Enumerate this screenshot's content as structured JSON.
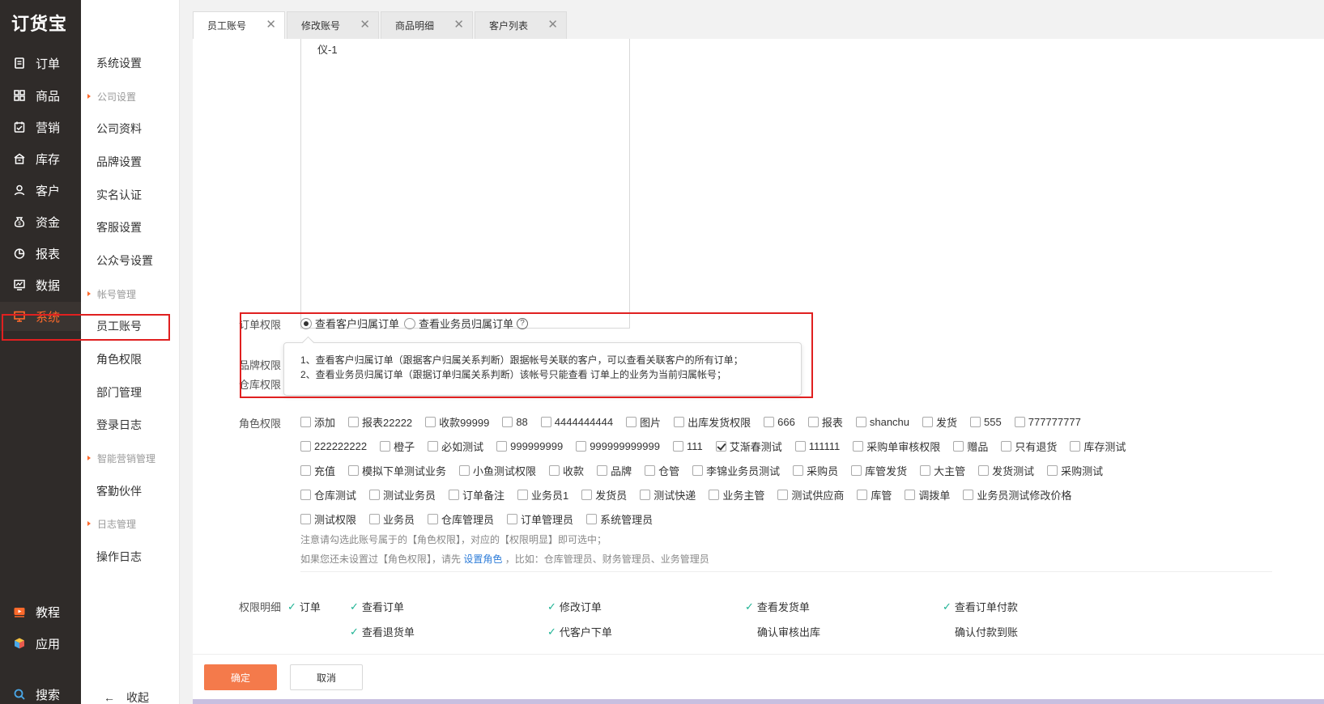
{
  "app": {
    "logo": "订货宝"
  },
  "nav": {
    "items": [
      {
        "label": "订单",
        "icon": "order-icon"
      },
      {
        "label": "商品",
        "icon": "grid-icon"
      },
      {
        "label": "营销",
        "icon": "marketing-icon"
      },
      {
        "label": "库存",
        "icon": "warehouse-icon"
      },
      {
        "label": "客户",
        "icon": "user-icon"
      },
      {
        "label": "资金",
        "icon": "money-icon"
      },
      {
        "label": "报表",
        "icon": "pie-chart-icon"
      },
      {
        "label": "数据",
        "icon": "data-icon"
      },
      {
        "label": "系统",
        "icon": "monitor-icon",
        "active": true
      }
    ],
    "bottom": [
      {
        "label": "教程",
        "icon": "video-icon"
      },
      {
        "label": "应用",
        "icon": "cube-icon"
      },
      {
        "label": "搜索",
        "icon": "search-icon"
      }
    ]
  },
  "submenu": {
    "top": "系统设置",
    "group1": "公司设置",
    "items1": [
      "公司资料",
      "品牌设置",
      "实名认证",
      "客服设置",
      "公众号设置"
    ],
    "group2": "帐号管理",
    "items2": [
      "员工账号",
      "角色权限",
      "部门管理",
      "登录日志"
    ],
    "group3": "智能营销管理",
    "items3": [
      "客勤伙伴"
    ],
    "group4": "日志管理",
    "items4": [
      "操作日志"
    ],
    "collapse": "收起"
  },
  "tabs": [
    {
      "label": "员工账号",
      "active": true
    },
    {
      "label": "修改账号"
    },
    {
      "label": "商品明细"
    },
    {
      "label": "客户列表"
    }
  ],
  "form": {
    "textarea_value": "仪-1",
    "order_perm_label": "订单权限",
    "order_perm_opt1": "查看客户归属订单",
    "order_perm_opt2": "查看业务员归属订单",
    "brand_perm_label": "品牌权限",
    "warehouse_perm_label": "仓库权限",
    "tooltip_line1": "1、查看客户归属订单（跟据客户归属关系判断）跟据帐号关联的客户，可以查看关联客户的所有订单；",
    "tooltip_line2": "2、查看业务员归属订单（跟据订单归属关系判断）该帐号只能查看 订单上的业务为当前归属帐号；",
    "role_perm_label": "角色权限",
    "roles": [
      [
        "添加",
        "报表22222",
        "收款99999",
        "88",
        "4444444444",
        "图片",
        "出库发货权限",
        "666",
        "报表",
        "shanchu",
        "发货",
        "555",
        "777777777"
      ],
      [
        "222222222",
        "橙子",
        "必如测试",
        "999999999",
        "999999999999",
        "111",
        "艾渐春测试",
        "111111",
        "采购单审核权限",
        "赠品",
        "只有退货",
        "库存测试"
      ],
      [
        "充值",
        "模拟下单测试业务",
        "小鱼测试权限",
        "收款",
        "品牌",
        "仓管",
        "李锦业务员测试",
        "采购员",
        "库管发货",
        "大主管",
        "发货测试",
        "采购测试"
      ],
      [
        "仓库测试",
        "测试业务员",
        "订单备注",
        "业务员1",
        "发货员",
        "测试快递",
        "业务主管",
        "测试供应商",
        "库管",
        "调拨单",
        "业务员测试修改价格"
      ],
      [
        "测试权限",
        "业务员",
        "仓库管理员",
        "订单管理员",
        "系统管理员"
      ]
    ],
    "checked_role": "艾渐春测试",
    "note1": "注意请勾选此账号属于的【角色权限】，对应的【权限明显】即可选中；",
    "note2_pre": "如果您还未设置过【角色权限】，请先",
    "note2_link": "设置角色",
    "note2_post": "，比如：仓库管理员、财务管理员、业务管理员",
    "detail_label": "权限明细",
    "detail_group": "订单",
    "detail_items": [
      {
        "label": "查看订单",
        "checked": true
      },
      {
        "label": "修改订单",
        "checked": true
      },
      {
        "label": "查看发货单",
        "checked": true
      },
      {
        "label": "查看订单付款",
        "checked": true
      },
      {
        "label": "查看退货单",
        "checked": true
      },
      {
        "label": "代客户下单",
        "checked": true
      },
      {
        "label": "确认审核出库",
        "checked": false
      },
      {
        "label": "确认付款到账",
        "checked": false
      }
    ]
  },
  "buttons": {
    "ok": "确定",
    "cancel": "取消"
  },
  "colors": {
    "accent": "#ff6a2b",
    "nav_bg": "#2f2b29",
    "ok_btn": "#f47a4b",
    "highlight": "#e02020",
    "link": "#2d7cd8",
    "check": "#1eb394"
  }
}
